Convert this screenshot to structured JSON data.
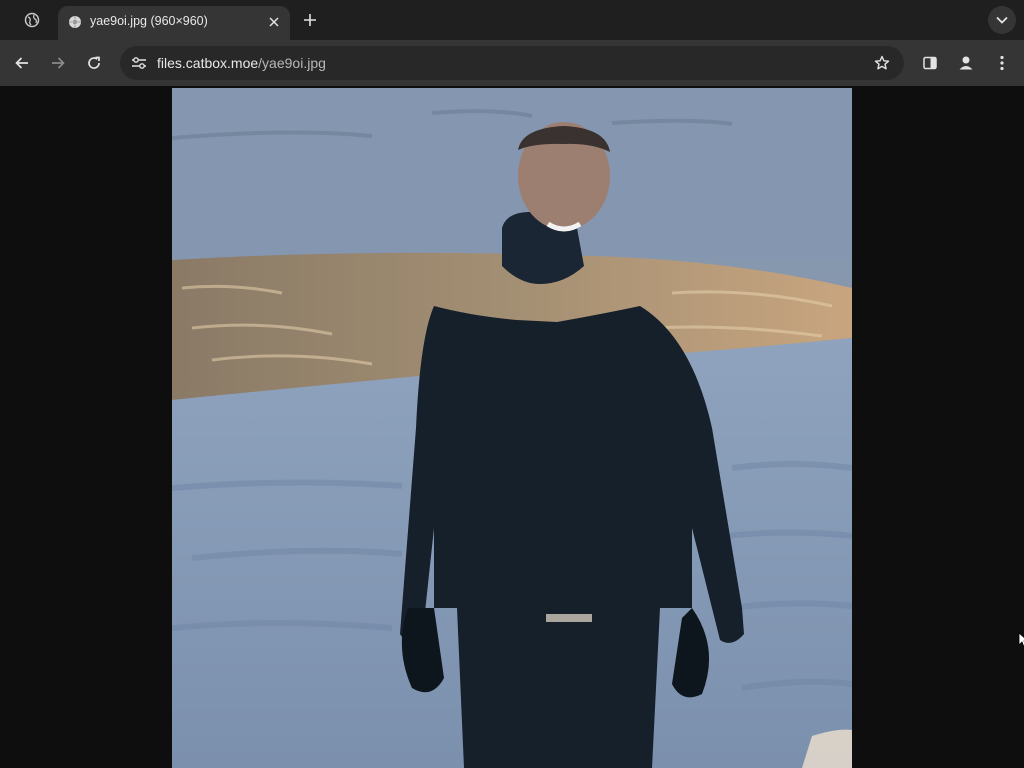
{
  "browser": {
    "tabs": [
      {
        "title": "yae9oi.jpg (960×960)",
        "active": true,
        "favicon": "image-favicon"
      }
    ],
    "inactive_tab_icon": "globe-icon",
    "new_tab_icon": "plus-icon",
    "tab_search_icon": "chevron-down-icon",
    "address_bar": {
      "host": "files.catbox.moe",
      "path": "/yae9oi.jpg"
    },
    "nav_icons": [
      "back-arrow-icon",
      "forward-arrow-icon",
      "reload-icon"
    ],
    "right_icons": [
      "star-icon",
      "side-panel-icon",
      "profile-icon",
      "more-vert-icon"
    ],
    "colors": {
      "tabstrip": "#1f1f1f",
      "toolbar": "#353535",
      "omnibox": "#282828",
      "viewer_bg": "#0e0e0e"
    }
  },
  "image": {
    "subject": "smiling man in dark hooded winter jacket and gloves standing on snowy frozen shore at dusk, wavy water with golden reflections behind",
    "colors": {
      "sky_snow": "#8798ae",
      "water_gold": "#b39b7c",
      "jacket": "#1a2530"
    }
  }
}
